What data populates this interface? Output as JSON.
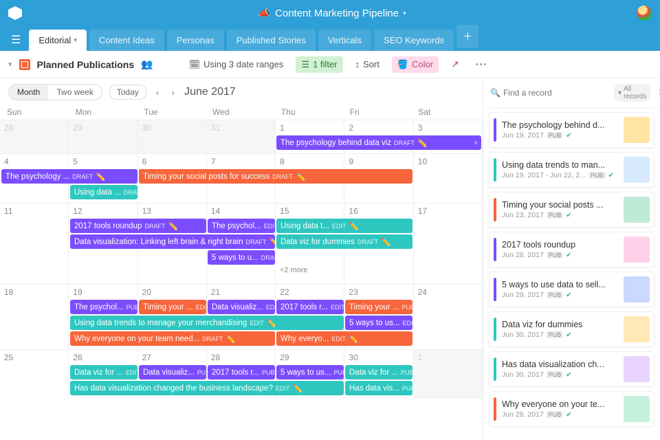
{
  "header": {
    "title": "Content Marketing Pipeline",
    "emoji": "📣"
  },
  "tabs": [
    {
      "label": "Editorial",
      "active": true
    },
    {
      "label": "Content Ideas"
    },
    {
      "label": "Personas"
    },
    {
      "label": "Published Stories"
    },
    {
      "label": "Verticals"
    },
    {
      "label": "SEO Keywords"
    }
  ],
  "toolbar": {
    "view_name": "Planned Publications",
    "date_ranges": "Using 3 date ranges",
    "filter": "1 filter",
    "sort": "Sort",
    "color": "Color",
    "more": "•••"
  },
  "calendar_header": {
    "seg_month": "Month",
    "seg_twoweek": "Two week",
    "today": "Today",
    "month_label": "June 2017"
  },
  "day_names": [
    "Sun",
    "Mon",
    "Tue",
    "Wed",
    "Thu",
    "Fri",
    "Sat"
  ],
  "weeks": [
    {
      "days": [
        {
          "num": "28",
          "out": true
        },
        {
          "num": "29",
          "out": true
        },
        {
          "num": "30",
          "out": true
        },
        {
          "num": "31",
          "out": true
        },
        {
          "num": "1"
        },
        {
          "num": "2"
        },
        {
          "num": "3"
        }
      ],
      "events": [
        {
          "row": 0,
          "start": 4,
          "span": 3,
          "color": "purple",
          "title": "The psychology behind data viz",
          "status": "DRAFT",
          "emoji": "✏️",
          "arrow": true
        }
      ]
    },
    {
      "days": [
        {
          "num": "4"
        },
        {
          "num": "5"
        },
        {
          "num": "6"
        },
        {
          "num": "7"
        },
        {
          "num": "8"
        },
        {
          "num": "9"
        },
        {
          "num": "10"
        }
      ],
      "events": [
        {
          "row": 0,
          "start": 0,
          "span": 2,
          "color": "purple",
          "title": "The psychology ...",
          "status": "DRAFT",
          "emoji": "✏️"
        },
        {
          "row": 0,
          "start": 2,
          "span": 4,
          "color": "orange",
          "title": "Timing your social posts for success",
          "status": "DRAFT",
          "emoji": "✏️"
        },
        {
          "row": 1,
          "start": 1,
          "span": 1,
          "color": "teal",
          "title": "Using data ...",
          "status": "DRAFT..."
        }
      ]
    },
    {
      "days": [
        {
          "num": "11"
        },
        {
          "num": "12"
        },
        {
          "num": "13"
        },
        {
          "num": "14"
        },
        {
          "num": "15"
        },
        {
          "num": "16"
        },
        {
          "num": "17"
        }
      ],
      "events": [
        {
          "row": 0,
          "start": 1,
          "span": 2,
          "color": "purple",
          "title": "2017 tools roundup",
          "status": "DRAFT",
          "emoji": "✏️"
        },
        {
          "row": 0,
          "start": 3,
          "span": 1,
          "color": "purple",
          "title": "The psychol...",
          "status": "EDIT",
          "emoji": "✏️"
        },
        {
          "row": 0,
          "start": 4,
          "span": 2,
          "color": "teal",
          "title": "Using data t...",
          "status": "EDIT",
          "emoji": "✏️"
        },
        {
          "row": 1,
          "start": 1,
          "span": 3,
          "color": "purple",
          "title": "Data visualization: Linking left brain & right brain",
          "status": "DRAFT",
          "emoji": "✏️"
        },
        {
          "row": 1,
          "start": 4,
          "span": 2,
          "color": "teal",
          "title": "Data viz for dummies",
          "status": "DRAFT",
          "emoji": "✏️"
        },
        {
          "row": 2,
          "start": 3,
          "span": 1,
          "color": "purple",
          "title": "5 ways to u...",
          "status": "DRAFT..."
        }
      ],
      "more": {
        "col": 4,
        "text": "+2 more"
      }
    },
    {
      "days": [
        {
          "num": "18"
        },
        {
          "num": "19"
        },
        {
          "num": "20"
        },
        {
          "num": "21"
        },
        {
          "num": "22"
        },
        {
          "num": "23"
        },
        {
          "num": "24"
        }
      ],
      "events": [
        {
          "row": 0,
          "start": 1,
          "span": 1,
          "color": "purple",
          "title": "The psychol...",
          "status": "PUB",
          "check": true
        },
        {
          "row": 0,
          "start": 2,
          "span": 1,
          "color": "orange",
          "title": "Timing your ...",
          "status": "EDIT",
          "emoji": "✏️"
        },
        {
          "row": 0,
          "start": 3,
          "span": 1,
          "color": "purple",
          "title": "Data visualiz...",
          "status": "EDIT",
          "emoji": "✏️"
        },
        {
          "row": 0,
          "start": 4,
          "span": 1,
          "color": "purple",
          "title": "2017 tools r...",
          "status": "EDIT",
          "emoji": "✏️"
        },
        {
          "row": 0,
          "start": 5,
          "span": 1,
          "color": "orange",
          "title": "Timing your ...",
          "status": "PUB",
          "check": true
        },
        {
          "row": 1,
          "start": 1,
          "span": 4,
          "color": "teal",
          "title": "Using data trends to manage your merchandising",
          "status": "EDIT",
          "emoji": "✏️"
        },
        {
          "row": 1,
          "start": 5,
          "span": 1,
          "color": "purple",
          "title": "5 ways to us...",
          "status": "EDIT",
          "emoji": "✏️"
        },
        {
          "row": 2,
          "start": 1,
          "span": 3,
          "color": "orange",
          "title": "Why everyone on your team need...",
          "status": "DRAFT",
          "emoji": "✏️"
        },
        {
          "row": 2,
          "start": 4,
          "span": 2,
          "color": "orange",
          "title": "Why everyo...",
          "status": "EDIT",
          "emoji": "✏️"
        }
      ]
    },
    {
      "days": [
        {
          "num": "25"
        },
        {
          "num": "26"
        },
        {
          "num": "27"
        },
        {
          "num": "28"
        },
        {
          "num": "29"
        },
        {
          "num": "30"
        },
        {
          "num": "1",
          "out": true
        }
      ],
      "events": [
        {
          "row": 0,
          "start": 1,
          "span": 1,
          "color": "teal",
          "title": "Data viz for ...",
          "status": "EDIT",
          "emoji": "✏️"
        },
        {
          "row": 0,
          "start": 2,
          "span": 1,
          "color": "purple",
          "title": "Data visualiz...",
          "status": "PUB",
          "check": true
        },
        {
          "row": 0,
          "start": 3,
          "span": 1,
          "color": "purple",
          "title": "2017 tools r...",
          "status": "PUB",
          "check": true
        },
        {
          "row": 0,
          "start": 4,
          "span": 1,
          "color": "purple",
          "title": "5 ways to us...",
          "status": "PUB",
          "check": true
        },
        {
          "row": 0,
          "start": 5,
          "span": 1,
          "color": "teal",
          "title": "Data viz for ...",
          "status": "PUB",
          "check": true
        },
        {
          "row": 1,
          "start": 1,
          "span": 4,
          "color": "teal",
          "title": "Has data visualization changed the business landscape?",
          "status": "EDIT",
          "emoji": "✏️"
        },
        {
          "row": 1,
          "start": 5,
          "span": 1,
          "color": "teal",
          "title": "Has data vis...",
          "status": "PUB",
          "check": true
        }
      ]
    }
  ],
  "side": {
    "search_placeholder": "Find a record",
    "all_records": "All records",
    "pub_label": "PUB",
    "records": [
      {
        "color": "purple",
        "title": "The psychology behind d...",
        "date": "Jun 19, 2017",
        "thumb": "#ffe4a3"
      },
      {
        "color": "teal",
        "title": "Using data trends to man...",
        "date": "Jun 19, 2017 - Jun 22, 2...",
        "thumb": "#d7eafd"
      },
      {
        "color": "orange",
        "title": "Timing your social posts ...",
        "date": "Jun 23, 2017",
        "thumb": "#bfead6"
      },
      {
        "color": "purple",
        "title": "2017 tools roundup",
        "date": "Jun 28, 2017",
        "thumb": "#ffd1e8"
      },
      {
        "color": "purple",
        "title": "5 ways to use data to sell...",
        "date": "Jun 29, 2017",
        "thumb": "#cbd8ff"
      },
      {
        "color": "teal",
        "title": "Data viz for dummies",
        "date": "Jun 30, 2017",
        "thumb": "#ffe9b7"
      },
      {
        "color": "teal",
        "title": "Has data visualization ch...",
        "date": "Jun 30, 2017",
        "thumb": "#e8d4ff"
      },
      {
        "color": "orange",
        "title": "Why everyone on your te...",
        "date": "Jun 28, 2017",
        "thumb": "#c5f0dc"
      }
    ]
  }
}
